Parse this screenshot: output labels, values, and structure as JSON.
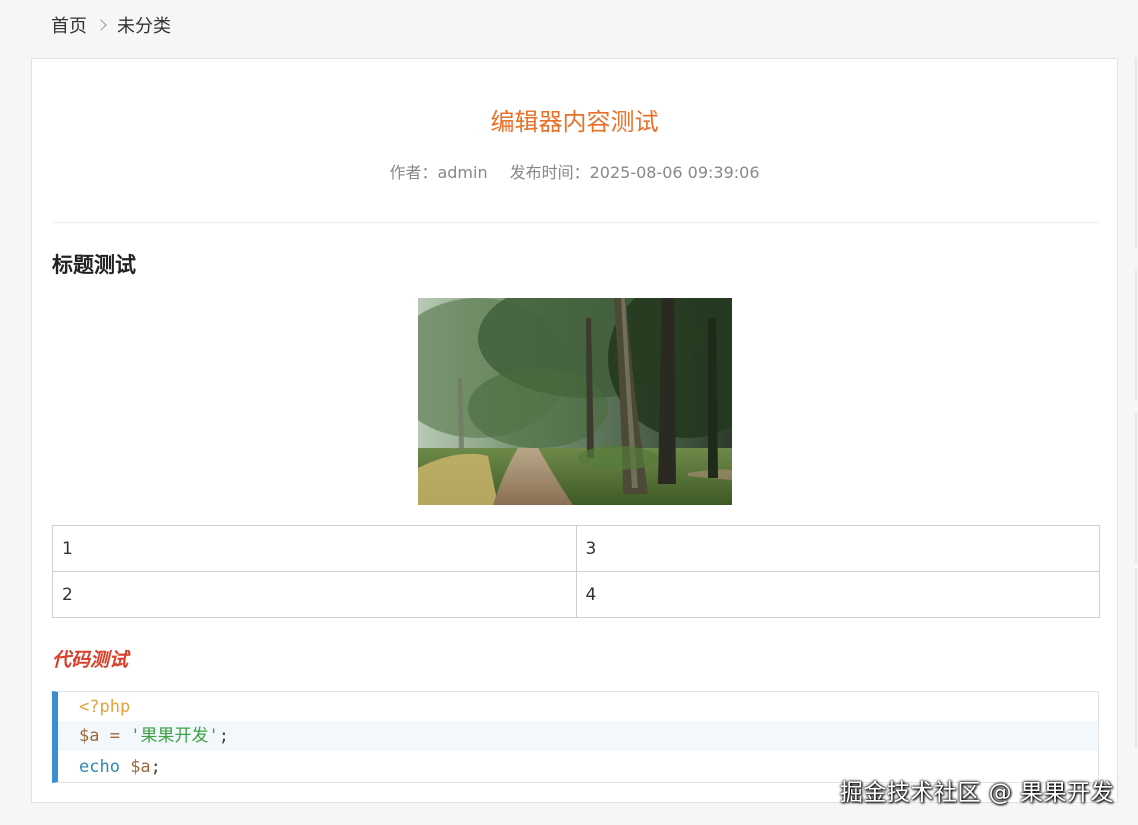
{
  "breadcrumb": {
    "home": "首页",
    "category": "未分类"
  },
  "article": {
    "title": "编辑器内容测试",
    "author_label": "作者：",
    "author": "admin",
    "time_label": "发布时间：",
    "time": "2025-08-06 09:39:06"
  },
  "content": {
    "heading": "标题测试",
    "table": [
      [
        "1",
        "3"
      ],
      [
        "2",
        "4"
      ]
    ],
    "code_heading": "代码测试",
    "code": {
      "line1": "<?php",
      "line2_var": "$a",
      "line2_op": " = ",
      "line2_str": "'果果开发'",
      "line2_end": ";",
      "line3_kw": "echo",
      "line3_var": " $a",
      "line3_end": ";"
    }
  },
  "watermark": "掘金技术社区 @ 果果开发",
  "colors": {
    "title": "#e8712a",
    "code_heading": "#d9412b",
    "code_border": "#3a8ed4"
  }
}
